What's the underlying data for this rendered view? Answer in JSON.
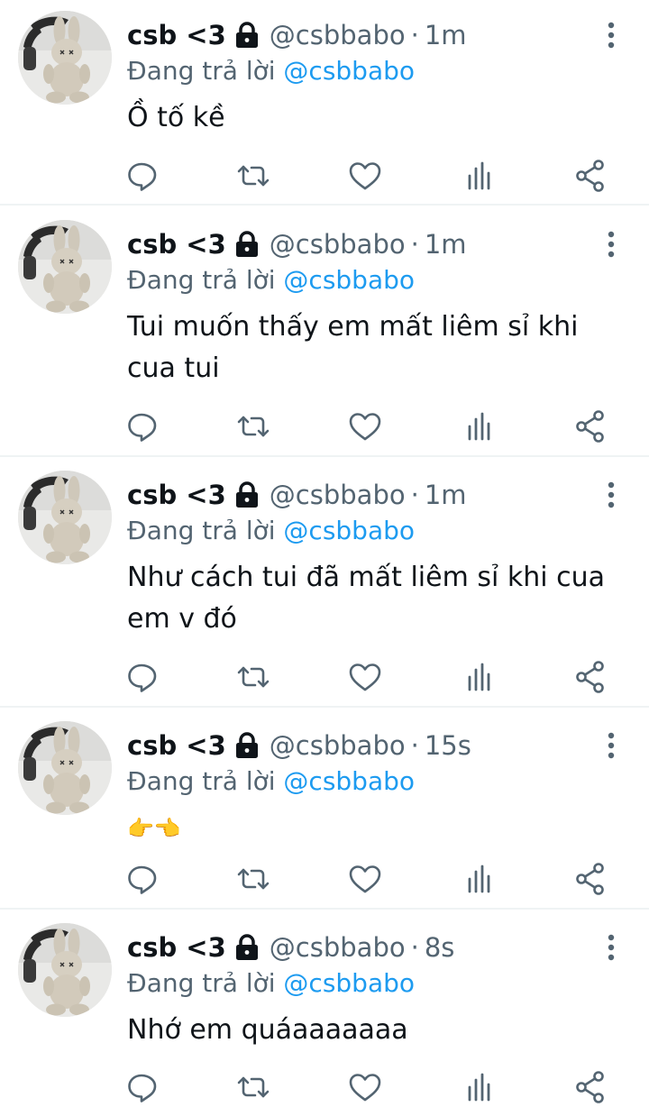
{
  "colors": {
    "text": "#0f1419",
    "secondary": "#536471",
    "mention": "#1d9bf0",
    "icon": "#536471",
    "divider": "#eff3f4"
  },
  "tweets": [
    {
      "name": "csb <3",
      "handle": "@csbbabo",
      "dot": "·",
      "time": "1m",
      "reply_prefix": "Đang trả lời",
      "reply_to": "@csbbabo",
      "text": "Ồ tố kề"
    },
    {
      "name": "csb <3",
      "handle": "@csbbabo",
      "dot": "·",
      "time": "1m",
      "reply_prefix": "Đang trả lời",
      "reply_to": "@csbbabo",
      "text": "Tui muốn thấy em mất liêm sỉ khi cua tui"
    },
    {
      "name": "csb <3",
      "handle": "@csbbabo",
      "dot": "·",
      "time": "1m",
      "reply_prefix": "Đang trả lời",
      "reply_to": "@csbbabo",
      "text": "Như cách tui đã mất liêm sỉ khi cua em v đó"
    },
    {
      "name": "csb <3",
      "handle": "@csbbabo",
      "dot": "·",
      "time": "15s",
      "reply_prefix": "Đang trả lời",
      "reply_to": "@csbbabo",
      "text": "👉👈"
    },
    {
      "name": "csb <3",
      "handle": "@csbbabo",
      "dot": "·",
      "time": "8s",
      "reply_prefix": "Đang trả lời",
      "reply_to": "@csbbabo",
      "text": "Nhớ em quáaaaaaaa"
    }
  ],
  "icons": {
    "lock": "lock-icon",
    "more": "more-vertical-icon",
    "reply": "reply-icon",
    "retweet": "retweet-icon",
    "like": "heart-icon",
    "views": "analytics-icon",
    "share": "share-icon"
  }
}
